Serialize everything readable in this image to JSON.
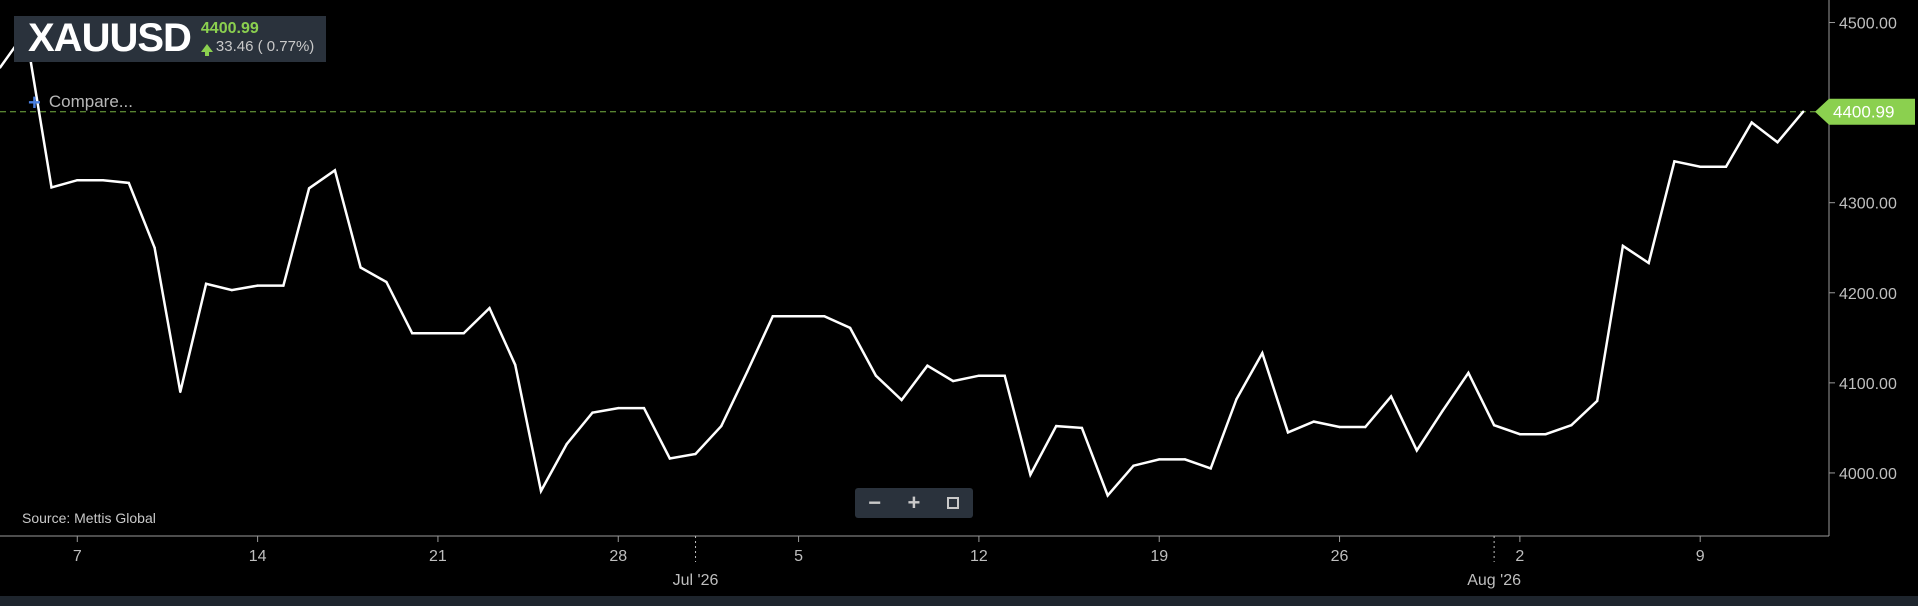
{
  "ticker": {
    "symbol": "XAUUSD",
    "price": "4400.99",
    "change": "33.46 ( 0.77%)",
    "change_direction_icon": "arrow-up-icon"
  },
  "compare_label": "Compare...",
  "source_label": "Source: Mettis Global",
  "zoom": {
    "zoom_out_icon": "minus-icon",
    "zoom_in_icon": "plus-icon",
    "fullscreen_icon": "fullscreen-icon"
  },
  "colors": {
    "background": "#000000",
    "line": "#ffffff",
    "last_price": "#8bd04f",
    "axis": "#bfbfbf",
    "toolbar": "#2a323c"
  },
  "chart_data": {
    "type": "line",
    "title": "",
    "xlabel": "",
    "ylabel": "",
    "grid": false,
    "ylim": [
      3930,
      4525
    ],
    "y_ticks": [
      "4000.00",
      "4100.00",
      "4200.00",
      "4300.00",
      "4400.00",
      "4500.00"
    ],
    "x_ticks": [
      {
        "date": "2026-06-07",
        "label": "7"
      },
      {
        "date": "2026-06-14",
        "label": "14"
      },
      {
        "date": "2026-06-21",
        "label": "21"
      },
      {
        "date": "2026-06-28",
        "label": "28"
      },
      {
        "date": "2026-07-05",
        "label": "5"
      },
      {
        "date": "2026-07-12",
        "label": "12"
      },
      {
        "date": "2026-07-19",
        "label": "19"
      },
      {
        "date": "2026-07-26",
        "label": "26"
      },
      {
        "date": "2026-08-02",
        "label": "2"
      },
      {
        "date": "2026-08-09",
        "label": "9"
      }
    ],
    "month_labels": [
      {
        "date": "2026-07-01",
        "label": "Jul '26"
      },
      {
        "date": "2026-08-01",
        "label": "Aug '26"
      }
    ],
    "x_range": [
      "2026-06-04",
      "2026-08-14"
    ],
    "last_price_label": "4400.99",
    "last_price": 4400.99,
    "series": [
      {
        "x": [
          "2026-06-04",
          "2026-06-05",
          "2026-06-06",
          "2026-06-07",
          "2026-06-08",
          "2026-06-09",
          "2026-06-10",
          "2026-06-11",
          "2026-06-12",
          "2026-06-13",
          "2026-06-14",
          "2026-06-15",
          "2026-06-16",
          "2026-06-17",
          "2026-06-18",
          "2026-06-19",
          "2026-06-20",
          "2026-06-21",
          "2026-06-22",
          "2026-06-23",
          "2026-06-24",
          "2026-06-25",
          "2026-06-26",
          "2026-06-27",
          "2026-06-28",
          "2026-06-29",
          "2026-06-30",
          "2026-07-01",
          "2026-07-02",
          "2026-07-03",
          "2026-07-04",
          "2026-07-05",
          "2026-07-06",
          "2026-07-07",
          "2026-07-08",
          "2026-07-09",
          "2026-07-10",
          "2026-07-11",
          "2026-07-12",
          "2026-07-13",
          "2026-07-14",
          "2026-07-15",
          "2026-07-16",
          "2026-07-17",
          "2026-07-18",
          "2026-07-19",
          "2026-07-20",
          "2026-07-21",
          "2026-07-22",
          "2026-07-23",
          "2026-07-24",
          "2026-07-25",
          "2026-07-26",
          "2026-07-27",
          "2026-07-28",
          "2026-07-29",
          "2026-07-30",
          "2026-07-31",
          "2026-08-01",
          "2026-08-02",
          "2026-08-03",
          "2026-08-04",
          "2026-08-05",
          "2026-08-06",
          "2026-08-07",
          "2026-08-08",
          "2026-08-09",
          "2026-08-10",
          "2026-08-11",
          "2026-08-12",
          "2026-08-13"
        ],
        "values": [
          4450,
          4490,
          4317,
          4325,
          4325,
          4322,
          4250,
          4090,
          4210,
          4203,
          4208,
          4208,
          4316,
          4336,
          4228,
          4212,
          4155,
          4155,
          4155,
          4183,
          4120,
          3980,
          4032,
          4067,
          4072,
          4072,
          4016,
          4021,
          4052,
          4112,
          4174,
          4174,
          4174,
          4161,
          4108,
          4081,
          4119,
          4102,
          4108,
          4108,
          3998,
          4052,
          4050,
          3975,
          4008,
          4015,
          4015,
          4005,
          4082,
          4133,
          4045,
          4057,
          4051,
          4051,
          4085,
          4025,
          4069,
          4111,
          4053,
          4043,
          4043,
          4053,
          4080,
          4252,
          4233,
          4346,
          4340,
          4340,
          4389,
          4367,
          4401
        ]
      }
    ]
  }
}
